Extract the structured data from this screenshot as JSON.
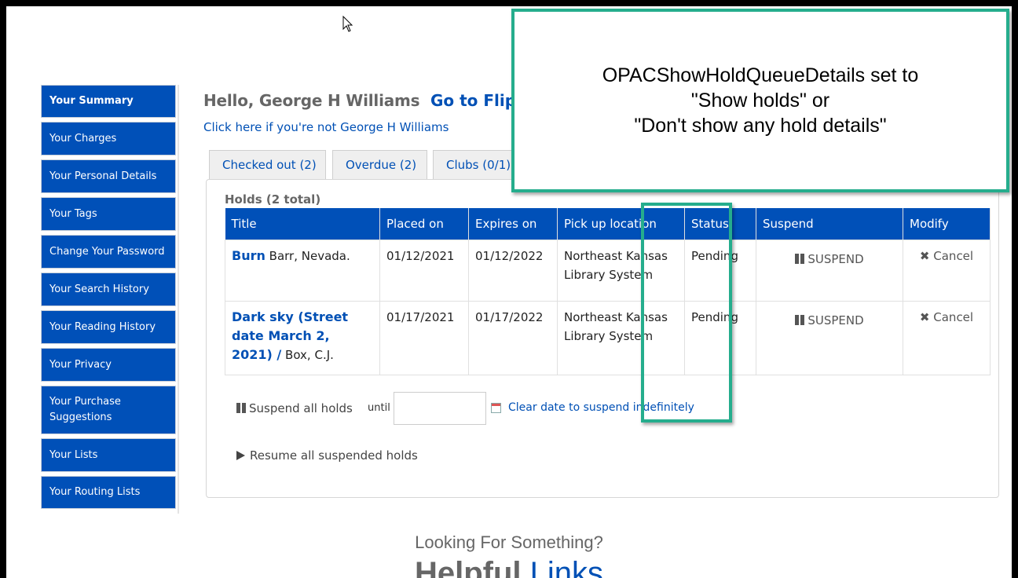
{
  "sidebar": {
    "items": [
      {
        "label": "Your Summary"
      },
      {
        "label": "Your Charges"
      },
      {
        "label": "Your Personal Details"
      },
      {
        "label": "Your Tags"
      },
      {
        "label": "Change Your Password"
      },
      {
        "label": "Your Search History"
      },
      {
        "label": "Your Reading History"
      },
      {
        "label": "Your Privacy"
      },
      {
        "label": "Your Purchase Suggestions"
      },
      {
        "label": "Your Lists"
      },
      {
        "label": "Your Routing Lists"
      }
    ]
  },
  "header": {
    "greeting": "Hello, George H Williams",
    "flips_link": "Go to Flips",
    "not_you_link": "Click here if you're not George H Williams"
  },
  "tabs": [
    {
      "label": "Checked out (2)"
    },
    {
      "label": "Overdue (2)"
    },
    {
      "label": "Clubs (0/1)"
    }
  ],
  "holds": {
    "title": "Holds (2 total)",
    "columns": [
      "Title",
      "Placed on",
      "Expires on",
      "Pick up location",
      "Status",
      "Suspend",
      "Modify"
    ],
    "rows": [
      {
        "title": "Burn",
        "author": "Barr, Nevada.",
        "placed_on": "01/12/2021",
        "expires_on": "01/12/2022",
        "pickup": "Northeast Kansas Library System",
        "status": "Pending",
        "suspend_label": "SUSPEND",
        "cancel_label": "Cancel"
      },
      {
        "title": "Dark sky (Street date March 2, 2021) /",
        "author": "Box, C.J.",
        "placed_on": "01/17/2021",
        "expires_on": "01/17/2022",
        "pickup": "Northeast Kansas Library System",
        "status": "Pending",
        "suspend_label": "SUSPEND",
        "cancel_label": "Cancel"
      }
    ],
    "suspend_all_label": "Suspend all holds",
    "until_label": "until",
    "until_value": "",
    "clear_date_link": "Clear date to suspend indefinitely",
    "resume_all_label": "Resume all suspended holds"
  },
  "footer": {
    "looking": "Looking For Something?",
    "helpful_part1": "Helpful",
    "helpful_part2": "Links"
  },
  "callout": {
    "line1": "OPACShowHoldQueueDetails set to",
    "line2": "\"Show holds\" or",
    "line3": "\"Don't show any hold details\""
  },
  "colors": {
    "accent_blue": "#0050b8",
    "callout_border": "#25ad8d"
  }
}
